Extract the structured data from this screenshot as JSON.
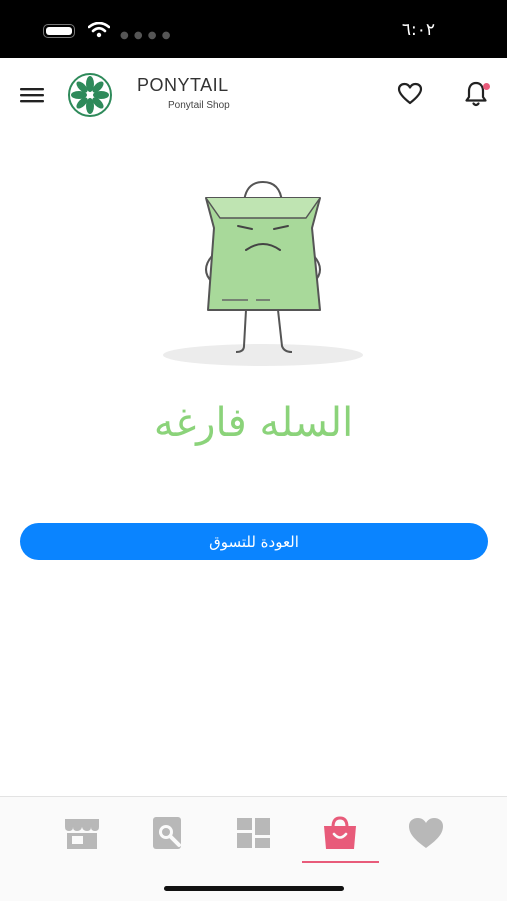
{
  "status_bar": {
    "time": "٦:٠٢"
  },
  "app_bar": {
    "brand_title": "PONYTAIL",
    "brand_subtitle": "Ponytail Shop",
    "icons": [
      "menu-icon",
      "heart-icon",
      "bell-icon"
    ]
  },
  "cart": {
    "empty_message": "السله فارغه",
    "back_button_label": "العودة للتسوق"
  },
  "tab_bar": {
    "tabs": [
      {
        "name": "store-icon"
      },
      {
        "name": "search-icon"
      },
      {
        "name": "categories-icon"
      },
      {
        "name": "cart-bag-icon",
        "active": true
      },
      {
        "name": "favorites-heart-icon"
      }
    ]
  },
  "colors": {
    "accent_green": "#8bd37a",
    "button_blue": "#0a84ff",
    "active_tab": "#e85b7a",
    "inactive_tab": "#b8b8b8"
  }
}
